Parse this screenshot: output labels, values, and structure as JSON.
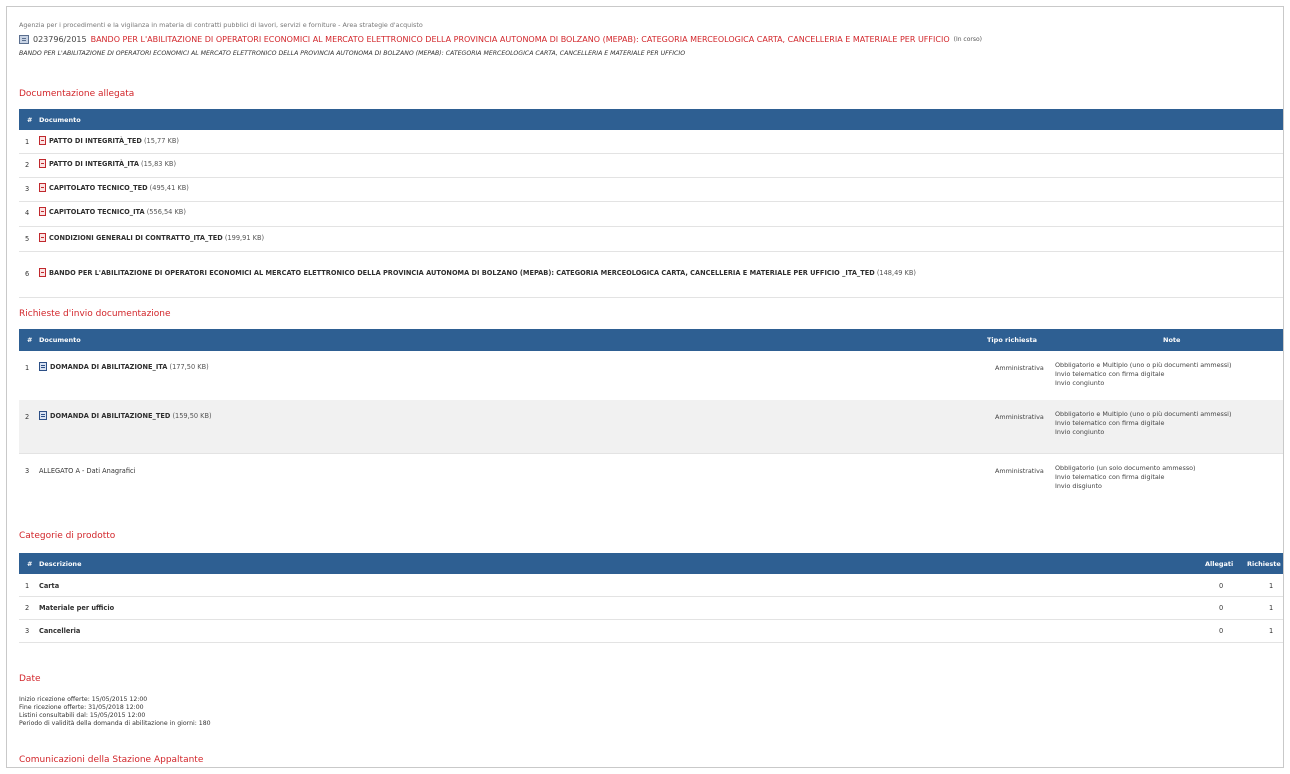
{
  "header": {
    "agency": "Agenzia per i procedimenti e la vigilanza in materia di contratti pubblici di lavori, servizi e forniture - Area strategie d'acquisto",
    "code": "023796/2015",
    "title": "BANDO PER L'ABILITAZIONE DI OPERATORI ECONOMICI AL MERCATO ELETTRONICO DELLA PROVINCIA AUTONOMA DI BOLZANO (MEPAB): CATEGORIA MERCEOLOGICA CARTA, CANCELLERIA E MATERIALE PER UFFICIO",
    "status": "(In corso)",
    "subtitle": "BANDO PER L'ABILITAZIONE DI OPERATORI ECONOMICI AL MERCATO ELETTRONICO DELLA PROVINCIA AUTONOMA DI BOLZANO (MEPAB): CATEGORIA MERCEOLOGICA CARTA, CANCELLERIA E MATERIALE PER UFFICIO"
  },
  "documentazione": {
    "title": "Documentazione allegata",
    "col_num": "#",
    "col_doc": "Documento",
    "rows": [
      {
        "num": "1",
        "name": "PATTO DI INTEGRITÀ_TED",
        "size": "(15,77 KB)"
      },
      {
        "num": "2",
        "name": "PATTO DI INTEGRITÀ_ITA",
        "size": "(15,83 KB)"
      },
      {
        "num": "3",
        "name": "CAPITOLATO TECNICO_TED",
        "size": "(495,41 KB)"
      },
      {
        "num": "4",
        "name": "CAPITOLATO TECNICO_ITA",
        "size": "(556,54 KB)"
      },
      {
        "num": "5",
        "name": "CONDIZIONI GENERALI DI CONTRATTO_ITA_TED",
        "size": "(199,91 KB)"
      },
      {
        "num": "6",
        "name": "BANDO PER L'ABILITAZIONE DI OPERATORI ECONOMICI AL MERCATO ELETTRONICO DELLA PROVINCIA AUTONOMA DI BOLZANO (MEPAB): CATEGORIA MERCEOLOGICA CARTA, CANCELLERIA E MATERIALE PER UFFICIO _ITA_TED",
        "size": "(148,49 KB)"
      }
    ]
  },
  "richieste": {
    "title": "Richieste d'invio documentazione",
    "col_num": "#",
    "col_doc": "Documento",
    "col_tipo": "Tipo richiesta",
    "col_note": "Note",
    "rows": [
      {
        "num": "1",
        "name": "DOMANDA DI ABILITAZIONE_ITA",
        "size": "(177,50 KB)",
        "tipo": "Amministrativa",
        "note1": "Obbligatorio e Multiplo (uno o più documenti ammessi)",
        "note2": "Invio telematico con firma digitale",
        "note3": "Invio congiunto"
      },
      {
        "num": "2",
        "name": "DOMANDA DI ABILITAZIONE_TED",
        "size": "(159,50 KB)",
        "tipo": "Amministrativa",
        "note1": "Obbligatorio e Multiplo (uno o più documenti ammessi)",
        "note2": "Invio telematico con firma digitale",
        "note3": "Invio congiunto"
      },
      {
        "num": "3",
        "name": "ALLEGATO A - Dati Anagrafici",
        "size": "",
        "tipo": "Amministrativa",
        "note1": "Obbligatorio (un solo documento ammesso)",
        "note2": "Invio telematico con firma digitale",
        "note3": "Invio disgiunto"
      }
    ]
  },
  "categorie": {
    "title": "Categorie di prodotto",
    "col_num": "#",
    "col_desc": "Descrizione",
    "col_allegati": "Allegati",
    "col_richieste": "Richieste",
    "rows": [
      {
        "num": "1",
        "desc": "Carta",
        "allegati": "0",
        "richieste": "1"
      },
      {
        "num": "2",
        "desc": "Materiale per ufficio",
        "allegati": "0",
        "richieste": "1"
      },
      {
        "num": "3",
        "desc": "Cancelleria",
        "allegati": "0",
        "richieste": "1"
      }
    ]
  },
  "date": {
    "title": "Date",
    "line1": "Inizio ricezione offerte: 15/05/2015 12:00",
    "line2": "Fine ricezione offerte: 31/05/2018 12:00",
    "line3": "Listini consultabili dal: 15/05/2015 12:00",
    "line4": "Periodo di validità della domanda di abilitazione in giorni: 180"
  },
  "comunicazioni": {
    "title": "Comunicazioni della Stazione Appaltante"
  },
  "colors": {
    "accent_red": "#d2262b",
    "header_blue": "#2e5f92"
  }
}
